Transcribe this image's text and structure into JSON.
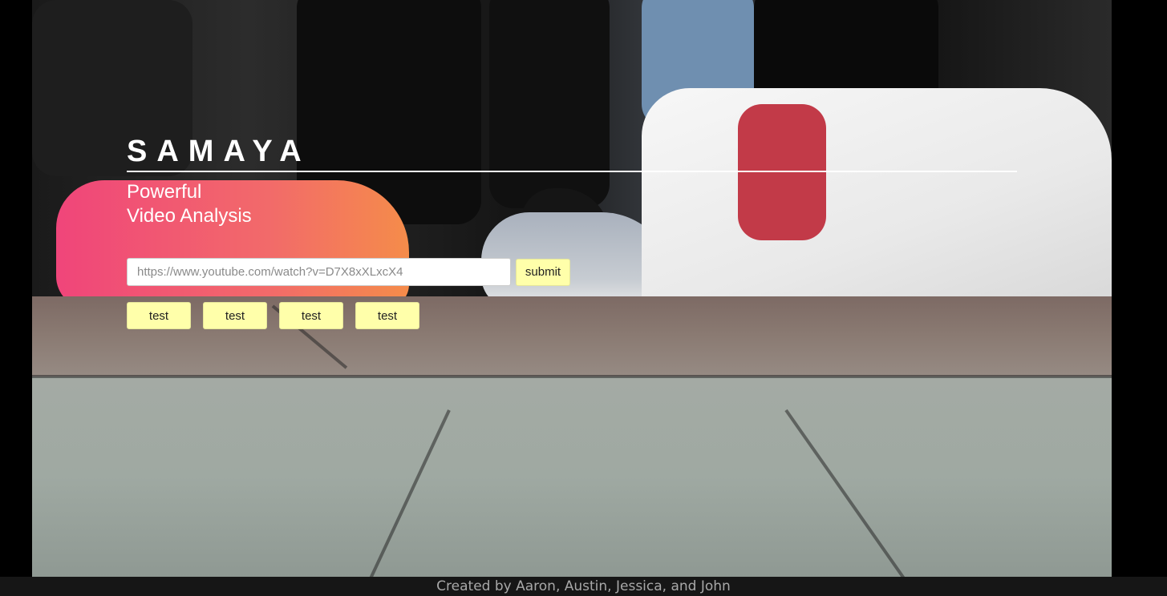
{
  "hero": {
    "brand": "SAMAYA",
    "tagline_line1": "Powerful",
    "tagline_line2": "Video Analysis"
  },
  "search": {
    "placeholder": "https://www.youtube.com/watch?v=D7X8xXLxcX4",
    "value": "",
    "submit_label": "submit"
  },
  "test_buttons": [
    {
      "label": "test"
    },
    {
      "label": "test"
    },
    {
      "label": "test"
    },
    {
      "label": "test"
    }
  ],
  "footer": {
    "credits": "Created by Aaron, Austin, Jessica, and John"
  },
  "colors": {
    "button_bg": "#ffffaa",
    "footer_bg": "#161616",
    "page_bg": "#000000"
  }
}
